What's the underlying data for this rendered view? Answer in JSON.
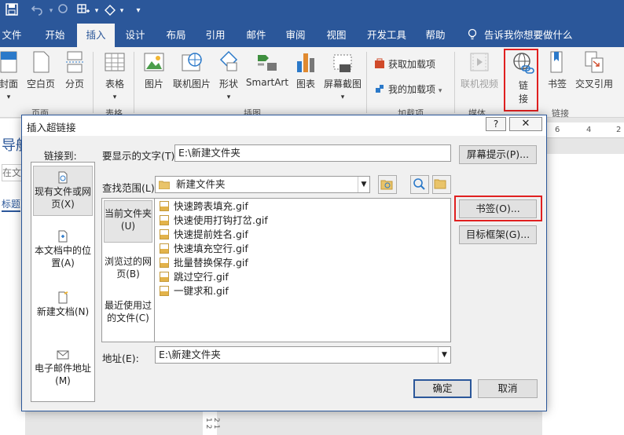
{
  "tabs": [
    "文件",
    "开始",
    "插入",
    "设计",
    "布局",
    "引用",
    "邮件",
    "审阅",
    "视图",
    "开发工具",
    "帮助"
  ],
  "active_tab": "插入",
  "tell_me": "告诉我你想要做什么",
  "ribbon": {
    "cover": "封面",
    "blank_page": "空白页",
    "page_break": "分页",
    "table": "表格",
    "picture": "图片",
    "online_picture": "联机图片",
    "shapes": "形状",
    "smartart": "SmartArt",
    "chart": "图表",
    "screenshot": "屏幕截图",
    "get_addins": "获取加载项",
    "my_addins": "我的加载项",
    "online_video": "联机视频",
    "link_line1": "链",
    "link_line2": "接",
    "bookmark": "书签",
    "cross_ref": "交叉引用",
    "groups": {
      "pages": "页面",
      "tables": "表格",
      "illustrations": "插图",
      "addins": "加载项",
      "media": "媒体",
      "links": "链接"
    }
  },
  "nav": {
    "title": "导航",
    "search": "在文",
    "headings": "标题"
  },
  "ruler_numbers": [
    "6",
    "4",
    "2"
  ],
  "side_ruler": "2 1 1 2",
  "dialog": {
    "title": "插入超链接",
    "help": "?",
    "link_to": "链接到:",
    "display_text_label": "要显示的文字(T):",
    "display_text_value": "E:\\新建文件夹",
    "screentip_button": "屏幕提示(P)...",
    "look_in_label": "查找范围(L):",
    "look_in_value": "新建文件夹",
    "link_items": [
      "现有文件或网页(X)",
      "本文档中的位置(A)",
      "新建文档(N)",
      "电子邮件地址(M)"
    ],
    "look_items": [
      "当前文件夹(U)",
      "浏览过的网页(B)",
      "最近使用过的文件(C)"
    ],
    "files": [
      "快速跨表填充.gif",
      "快速使用打钩打岔.gif",
      "快速提前姓名.gif",
      "快速填充空行.gif",
      "批量替换保存.gif",
      "跳过空行.gif",
      "一键求和.gif"
    ],
    "bookmark_button": "书签(O)...",
    "target_frame_button": "目标框架(G)...",
    "address_label": "地址(E):",
    "address_value": "E:\\新建文件夹",
    "ok": "确定",
    "cancel": "取消"
  }
}
